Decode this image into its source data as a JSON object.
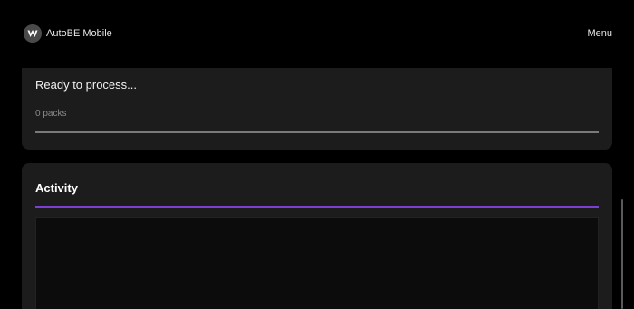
{
  "header": {
    "app_title": "AutoBE Mobile",
    "menu_label": "Menu",
    "logo_icon": "autobe-logo-icon"
  },
  "status": {
    "message": "Ready to process...",
    "packs_label": "0 packs",
    "progress": 0
  },
  "activity": {
    "title": "Activity",
    "accent_color": "#7b3fd4"
  },
  "colors": {
    "background": "#000000",
    "card": "#1c1c1c",
    "accent": "#7b3fd4"
  }
}
